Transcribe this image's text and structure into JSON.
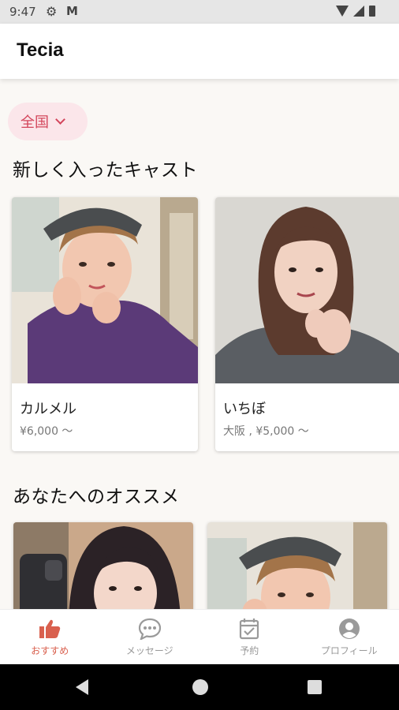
{
  "status_bar": {
    "time": "9:47"
  },
  "app_bar": {
    "title": "Tecia"
  },
  "region_filter": {
    "label": "全国"
  },
  "sections": {
    "new_casts": {
      "title": "新しく入ったキャスト",
      "cards": [
        {
          "name": "カルメル",
          "price": "¥6,000 〜"
        },
        {
          "name": "いちぼ",
          "price": "大阪 , ¥5,000 〜"
        }
      ]
    },
    "recommended": {
      "title": "あなたへのオススメ"
    }
  },
  "bottom_nav": {
    "items": [
      {
        "label": "おすすめ",
        "icon": "thumbs-up-icon",
        "active": true
      },
      {
        "label": "メッセージ",
        "icon": "chat-bubble-icon",
        "active": false
      },
      {
        "label": "予約",
        "icon": "calendar-check-icon",
        "active": false
      },
      {
        "label": "プロフィール",
        "icon": "account-circle-icon",
        "active": false
      }
    ]
  },
  "colors": {
    "accent": "#d3455b",
    "nav_active": "#d9604e",
    "chip_bg": "#fbe6ea",
    "background": "#faf8f5"
  }
}
